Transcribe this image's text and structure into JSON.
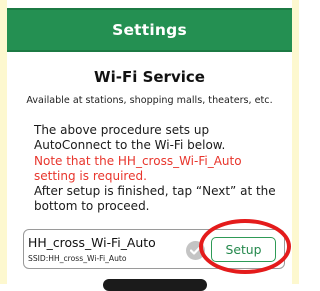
{
  "header": {
    "title": "Settings"
  },
  "service": {
    "title": "Wi-Fi Service",
    "subtitle": "Available at stations, shopping malls, theaters, etc."
  },
  "instructions": {
    "line1": "The above procedure sets up",
    "line2": "AutoConnect to the Wi-Fi below.",
    "warning_line1": "Note that the HH_cross_Wi-Fi_Auto",
    "warning_line2": "setting is required.",
    "line3": "After setup is finished, tap “Next” at the",
    "line4": "bottom to proceed."
  },
  "network": {
    "ssid_name": "HH_cross_Wi-Fi_Auto",
    "ssid_detail": "SSID:HH_cross_Wi-Fi_Auto",
    "status_icon": "check-circle-icon",
    "setup_label": "Setup"
  },
  "colors": {
    "header_bg": "#249052",
    "accent_green": "#24884c",
    "warning_red": "#e8352c",
    "highlight_red": "#e41b1b",
    "side_strip": "#fdf8cf"
  }
}
